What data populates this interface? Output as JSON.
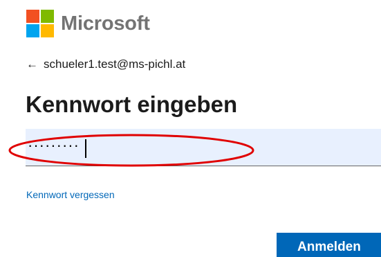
{
  "brand": {
    "name": "Microsoft",
    "colors": [
      "#f25022",
      "#7fba00",
      "#00a4ef",
      "#ffb900"
    ]
  },
  "identity": {
    "back_icon": "arrow-left-icon",
    "email": "schueler1.test@ms-pichl.at"
  },
  "page": {
    "title": "Kennwort eingeben"
  },
  "password_field": {
    "masked_value": "·········"
  },
  "links": {
    "forgot_password": "Kennwort vergessen"
  },
  "actions": {
    "submit_label": "Anmelden"
  },
  "theme": {
    "accent": "#0067b8",
    "annotation": "#e00000",
    "field_bg": "#e8f0fe"
  }
}
